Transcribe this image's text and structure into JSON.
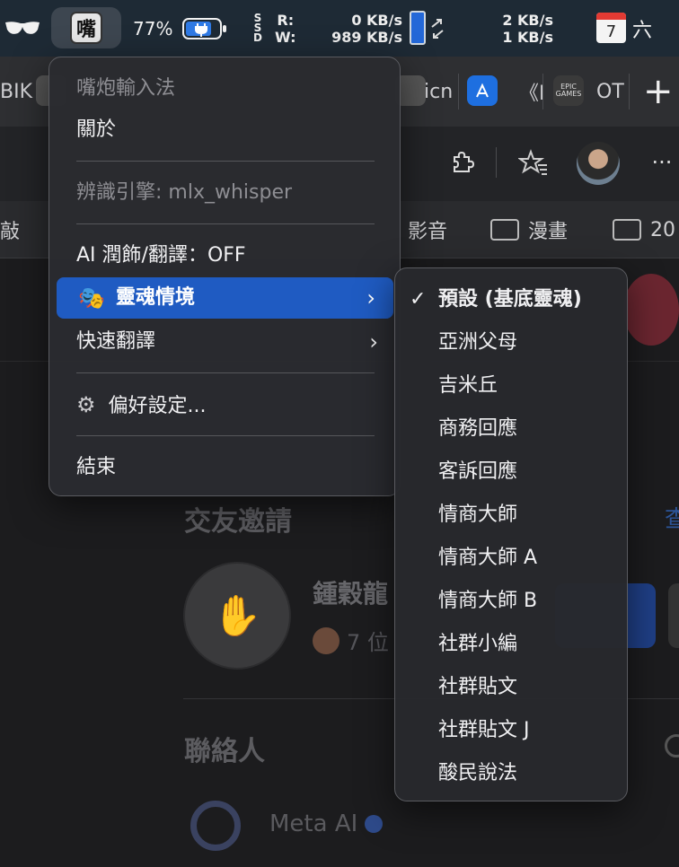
{
  "menubar": {
    "ime_icon_glyph": "嘴",
    "battery_percent": "77%",
    "ssd_label": [
      "S",
      "S",
      "D"
    ],
    "read_label": "R:",
    "write_label": "W:",
    "read_value": "0 KB/s",
    "write_value": "989 KB/s",
    "net_up": "2 KB/s",
    "net_down": "1 KB/s",
    "calendar_day": "7",
    "weekday": "六"
  },
  "browser": {
    "tab_fragments": [
      "BIK",
      "icn",
      "《I",
      "OT"
    ],
    "epic_label": "EPIC\nGAMES",
    "bookmarks": [
      "敲",
      "影音",
      "漫畫",
      "20"
    ]
  },
  "page": {
    "friend_requests_title": "交友邀請",
    "see_all": "查",
    "friend_name": "鍾穀龍",
    "mutual_friends": "7 位",
    "contacts_title": "聯絡人",
    "meta_ai": "Meta AI"
  },
  "menu": {
    "header": "嘴炮輸入法",
    "about": "關於",
    "engine": "辨識引擎: mlx_whisper",
    "ai_polish": "AI 潤飾/翻譯：OFF",
    "soul_context": "靈魂情境",
    "quick_translate": "快速翻譯",
    "preferences": "偏好設定...",
    "quit": "結束",
    "arrow": "›"
  },
  "submenu": {
    "checkmark": "✓",
    "items": [
      "預設 (基底靈魂)",
      "亞洲父母",
      "吉米丘",
      "商務回應",
      "客訴回應",
      "情商大師",
      "情商大師 A",
      "情商大師 B",
      "社群小編",
      "社群貼文",
      "社群貼文 J",
      "酸民說法"
    ],
    "selected_index": 0
  }
}
